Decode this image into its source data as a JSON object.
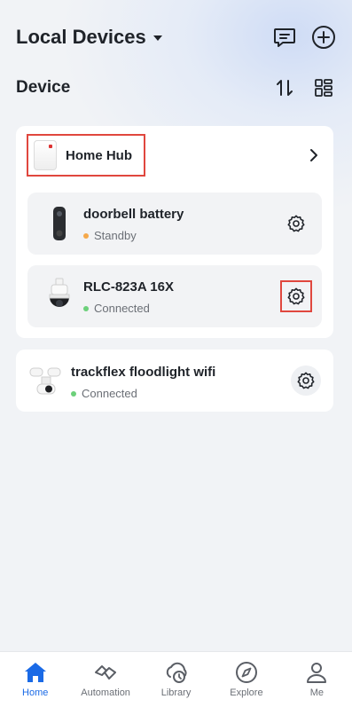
{
  "header": {
    "title": "Local Devices"
  },
  "section": {
    "title": "Device"
  },
  "hub": {
    "name": "Home Hub"
  },
  "hub_devices": [
    {
      "name": "doorbell battery",
      "status": "Standby",
      "status_color": "#f5a84a"
    },
    {
      "name": "RLC-823A 16X",
      "status": "Connected",
      "status_color": "#6cd07a"
    }
  ],
  "standalone_device": {
    "name": "trackflex floodlight wifi",
    "status": "Connected",
    "status_color": "#6cd07a"
  },
  "tabs": [
    {
      "label": "Home",
      "icon": "home-icon",
      "active": true
    },
    {
      "label": "Automation",
      "icon": "automation-icon",
      "active": false
    },
    {
      "label": "Library",
      "icon": "library-icon",
      "active": false
    },
    {
      "label": "Explore",
      "icon": "explore-icon",
      "active": false
    },
    {
      "label": "Me",
      "icon": "me-icon",
      "active": false
    }
  ],
  "colors": {
    "accent": "#1a6ae6",
    "highlight": "#e0473e"
  }
}
